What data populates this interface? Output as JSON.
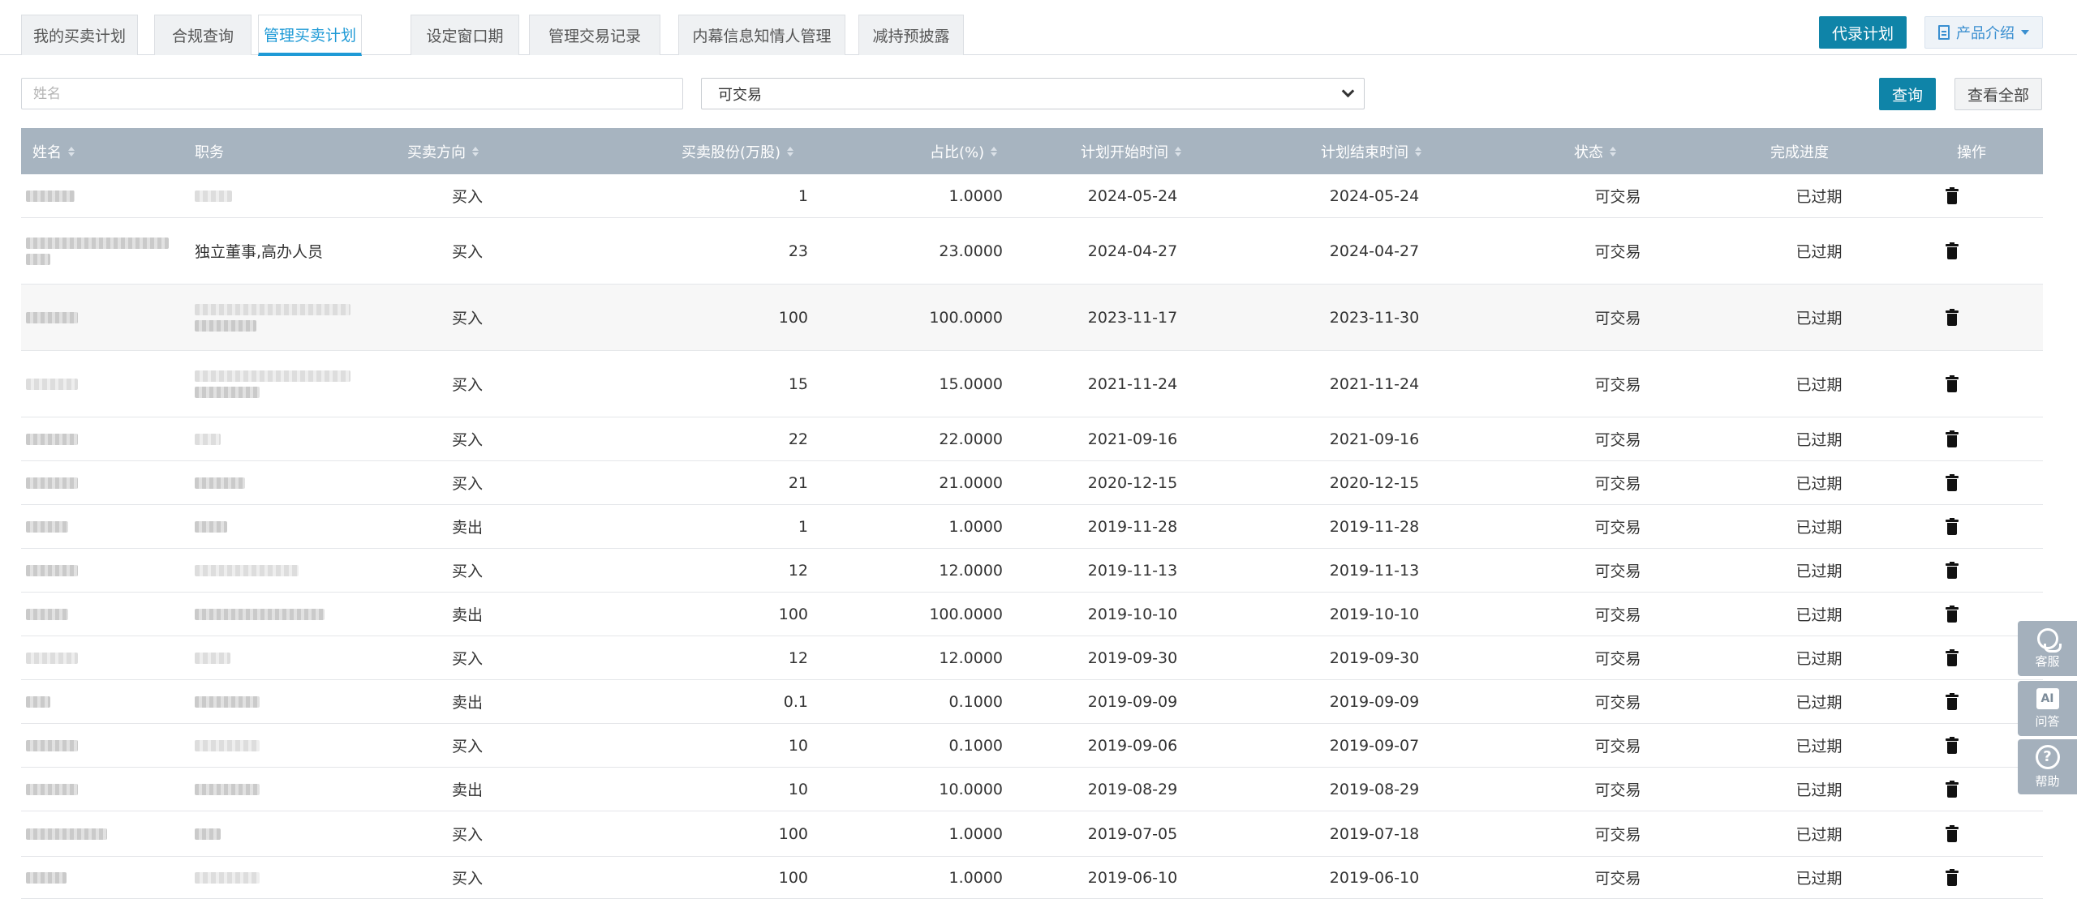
{
  "tabs": [
    {
      "label": "我的买卖计划",
      "active": false
    },
    {
      "label": "合规查询",
      "active": false
    },
    {
      "label": "管理买卖计划",
      "active": true
    },
    {
      "label": "设定窗口期",
      "active": false
    },
    {
      "label": "管理交易记录",
      "active": false
    },
    {
      "label": "内幕信息知情人管理",
      "active": false
    },
    {
      "label": "减持预披露",
      "active": false
    }
  ],
  "header_buttons": {
    "proxy_plan": "代录计划",
    "product_intro": "产品介绍"
  },
  "filters": {
    "name_placeholder": "姓名",
    "status_value": "可交易",
    "query_label": "查询",
    "view_all_label": "查看全部"
  },
  "columns": [
    "姓名",
    "职务",
    "买卖方向",
    "买卖股份(万股)",
    "占比(%)",
    "计划开始时间",
    "计划结束时间",
    "状态",
    "完成进度",
    "操作"
  ],
  "rows": [
    {
      "position": "",
      "direction": "买入",
      "shares": "1",
      "ratio": "1.0000",
      "start": "2024-05-24",
      "end": "2024-05-24",
      "status": "可交易",
      "progress": "已过期"
    },
    {
      "position": "独立董事,高办人员",
      "direction": "买入",
      "shares": "23",
      "ratio": "23.0000",
      "start": "2024-04-27",
      "end": "2024-04-27",
      "status": "可交易",
      "progress": "已过期"
    },
    {
      "position": "",
      "direction": "买入",
      "shares": "100",
      "ratio": "100.0000",
      "start": "2023-11-17",
      "end": "2023-11-30",
      "status": "可交易",
      "progress": "已过期"
    },
    {
      "position": "",
      "direction": "买入",
      "shares": "15",
      "ratio": "15.0000",
      "start": "2021-11-24",
      "end": "2021-11-24",
      "status": "可交易",
      "progress": "已过期"
    },
    {
      "position": "",
      "direction": "买入",
      "shares": "22",
      "ratio": "22.0000",
      "start": "2021-09-16",
      "end": "2021-09-16",
      "status": "可交易",
      "progress": "已过期"
    },
    {
      "position": "",
      "direction": "买入",
      "shares": "21",
      "ratio": "21.0000",
      "start": "2020-12-15",
      "end": "2020-12-15",
      "status": "可交易",
      "progress": "已过期"
    },
    {
      "position": "",
      "direction": "卖出",
      "shares": "1",
      "ratio": "1.0000",
      "start": "2019-11-28",
      "end": "2019-11-28",
      "status": "可交易",
      "progress": "已过期"
    },
    {
      "position": "",
      "direction": "买入",
      "shares": "12",
      "ratio": "12.0000",
      "start": "2019-11-13",
      "end": "2019-11-13",
      "status": "可交易",
      "progress": "已过期"
    },
    {
      "position": "",
      "direction": "卖出",
      "shares": "100",
      "ratio": "100.0000",
      "start": "2019-10-10",
      "end": "2019-10-10",
      "status": "可交易",
      "progress": "已过期"
    },
    {
      "position": "",
      "direction": "买入",
      "shares": "12",
      "ratio": "12.0000",
      "start": "2019-09-30",
      "end": "2019-09-30",
      "status": "可交易",
      "progress": "已过期"
    },
    {
      "position": "",
      "direction": "卖出",
      "shares": "0.1",
      "ratio": "0.1000",
      "start": "2019-09-09",
      "end": "2019-09-09",
      "status": "可交易",
      "progress": "已过期"
    },
    {
      "position": "",
      "direction": "买入",
      "shares": "10",
      "ratio": "0.1000",
      "start": "2019-09-06",
      "end": "2019-09-07",
      "status": "可交易",
      "progress": "已过期"
    },
    {
      "position": "",
      "direction": "卖出",
      "shares": "10",
      "ratio": "10.0000",
      "start": "2019-08-29",
      "end": "2019-08-29",
      "status": "可交易",
      "progress": "已过期"
    },
    {
      "position": "",
      "direction": "买入",
      "shares": "100",
      "ratio": "1.0000",
      "start": "2019-07-05",
      "end": "2019-07-18",
      "status": "可交易",
      "progress": "已过期"
    },
    {
      "position": "",
      "direction": "买入",
      "shares": "100",
      "ratio": "1.0000",
      "start": "2019-06-10",
      "end": "2019-06-10",
      "status": "可交易",
      "progress": "已过期"
    }
  ],
  "side_widgets": {
    "service": "客服",
    "ai": "AI",
    "ai_label": "问答",
    "help_label": "帮助"
  },
  "colors": {
    "primary": "#0f84a8",
    "active_tab": "#1e9ad6",
    "header_bg": "#a7b4c0"
  }
}
